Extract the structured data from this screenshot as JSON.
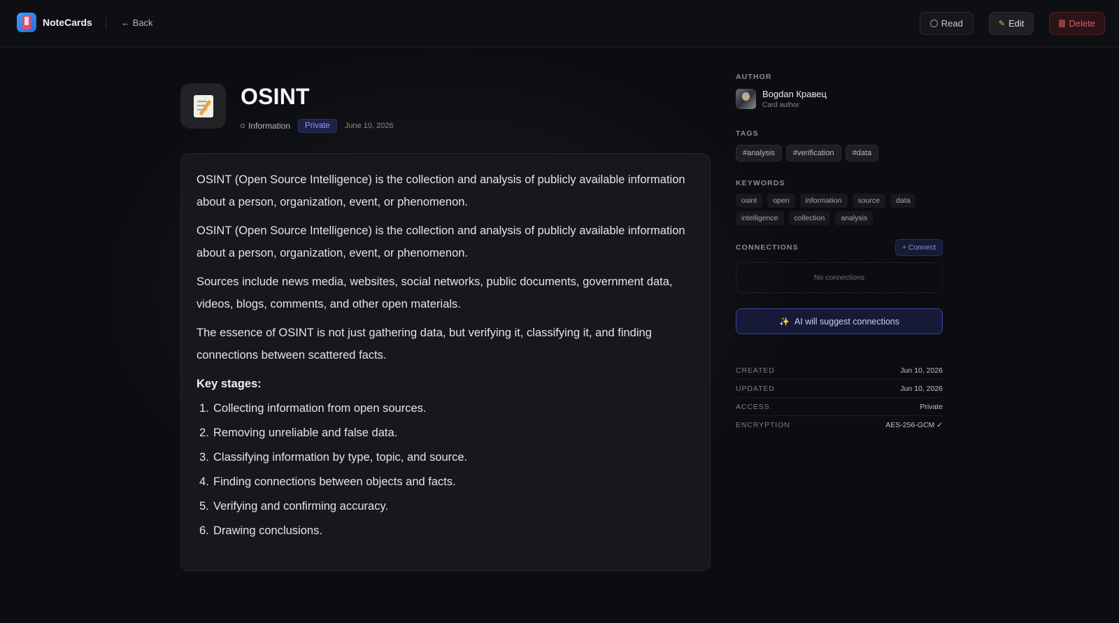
{
  "app": {
    "name": "NoteCards",
    "back_label": "← Back"
  },
  "toolbar": {
    "read_label": "Read",
    "edit_label": "Edit",
    "delete_label": "Delete"
  },
  "note": {
    "title": "OSINT",
    "category": "Information",
    "visibility": "Private",
    "date": "June 10, 2026",
    "paragraphs": [
      "OSINT (Open Source Intelligence) is the collection and analysis of publicly available information about a person, organization, event, or phenomenon.",
      "OSINT (Open Source Intelligence) is the collection and analysis of publicly available information about a person, organization, event, or phenomenon.",
      "Sources include news media, websites, social networks, public documents, government data, videos, blogs, comments, and other open materials.",
      "The essence of OSINT is not just gathering data, but verifying it, classifying it, and finding connections between scattered facts."
    ],
    "key_heading": "Key stages:",
    "stages": [
      {
        "num": "1.",
        "text": "Collecting information from open sources."
      },
      {
        "num": "2.",
        "text": "Removing unreliable and false data."
      },
      {
        "num": "3.",
        "text": "Classifying information by type, topic, and source."
      },
      {
        "num": "4.",
        "text": "Finding connections between objects and facts."
      },
      {
        "num": "5.",
        "text": "Verifying and confirming accuracy."
      },
      {
        "num": "6.",
        "text": "Drawing conclusions."
      }
    ]
  },
  "sidebar": {
    "author_label": "AUTHOR",
    "author_name": "Bogdan Кравец",
    "author_role": "Card author",
    "tags_label": "TAGS",
    "tags": [
      "#analysis",
      "#verification",
      "#data"
    ],
    "keywords_label": "KEYWORDS",
    "keywords": [
      "osint",
      "open",
      "information",
      "source",
      "data",
      "intelligence",
      "collection",
      "analysis"
    ],
    "connections_label": "CONNECTIONS",
    "connect_label": "+ Connect",
    "no_connections": "No connections",
    "ai_suggest_label": "AI will suggest connections",
    "info": [
      {
        "key": "CREATED",
        "value": "Jun 10, 2026"
      },
      {
        "key": "UPDATED",
        "value": "Jun 10, 2026"
      },
      {
        "key": "ACCESS",
        "value": "Private"
      },
      {
        "key": "ENCRYPTION",
        "value": "AES-256-GCM ✓"
      }
    ]
  },
  "colors": {
    "background": "#0c0d10",
    "accent": "#8e9cf5",
    "delete": "#e05a66"
  }
}
